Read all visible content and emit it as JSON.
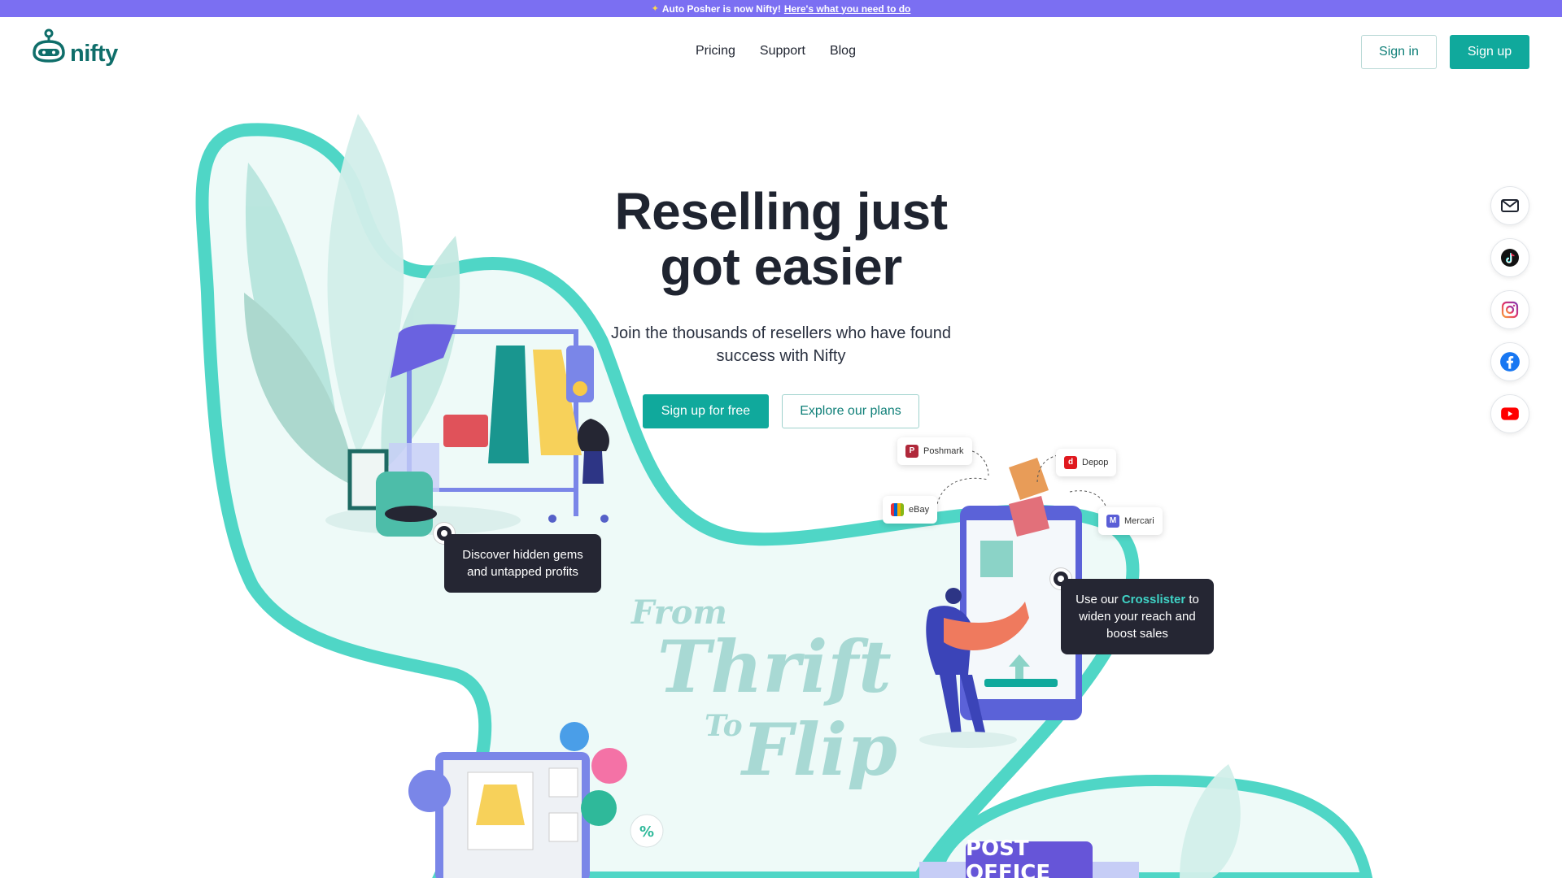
{
  "announcement": {
    "text": "Auto Posher is now Nifty!",
    "link": "Here's what you need to do"
  },
  "brand": {
    "name": "nifty"
  },
  "nav": {
    "items": [
      "Pricing",
      "Support",
      "Blog"
    ],
    "signin": "Sign in",
    "signup": "Sign up"
  },
  "hero": {
    "title_line1": "Reselling just",
    "title_line2": "got easier",
    "subtitle": "Join the thousands of resellers who have found success with Nifty",
    "cta_primary": "Sign up for free",
    "cta_secondary": "Explore our plans"
  },
  "callouts": {
    "gems": "Discover hidden gems and untapped profits",
    "crosslister_pre": "Use our",
    "crosslister_hl": "Crosslister",
    "crosslister_post": "to widen your reach and boost sales"
  },
  "marketplaces": [
    "Poshmark",
    "Depop",
    "eBay",
    "Mercari"
  ],
  "illustration": {
    "from": "From",
    "thrift": "Thrift",
    "to": "To",
    "flip": "Flip",
    "post_office": "POST OFFICE"
  },
  "social": [
    "mail-icon",
    "tiktok-icon",
    "instagram-icon",
    "facebook-icon",
    "youtube-icon"
  ],
  "colors": {
    "accent": "#10a99c",
    "announce": "#7b6ff2",
    "dark": "#252633",
    "teal_wave": "#4fd6c6"
  }
}
